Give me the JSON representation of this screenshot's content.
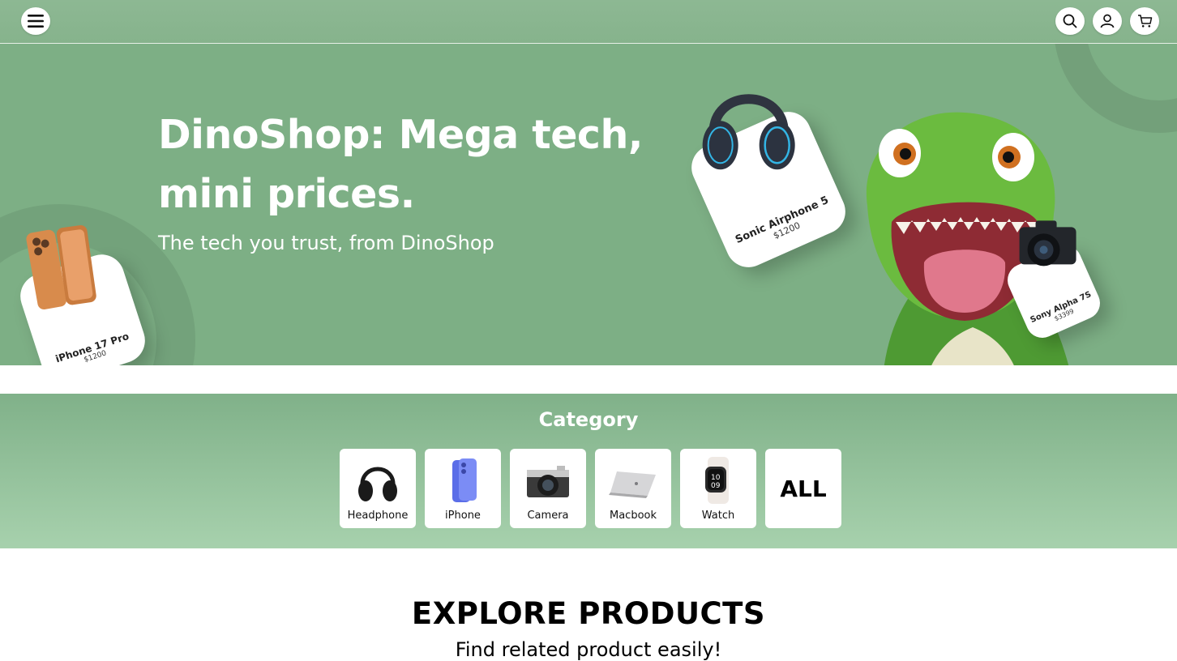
{
  "header": {
    "menu_icon": "hamburger-menu-icon",
    "actions": [
      {
        "name": "search",
        "icon": "search-icon"
      },
      {
        "name": "account",
        "icon": "user-icon"
      },
      {
        "name": "cart",
        "icon": "cart-icon"
      }
    ]
  },
  "hero": {
    "title_line1": "DinoShop: Mega tech,",
    "title_line2": "mini prices.",
    "subtitle": "The tech you trust, from DinoShop",
    "featured": [
      {
        "name": "iPhone 17 Pro",
        "price": "$1200"
      },
      {
        "name": "Sonic Airphone 5",
        "price": "$1200"
      },
      {
        "name": "Sony Alpha 7S",
        "price": "$3399"
      }
    ]
  },
  "category": {
    "title": "Category",
    "items": [
      {
        "label": "Headphone",
        "icon": "headphone-icon"
      },
      {
        "label": "iPhone",
        "icon": "iphone-icon"
      },
      {
        "label": "Camera",
        "icon": "camera-icon"
      },
      {
        "label": "Macbook",
        "icon": "macbook-icon"
      },
      {
        "label": "Watch",
        "icon": "watch-icon"
      },
      {
        "label": "ALL",
        "icon": ""
      }
    ]
  },
  "explore": {
    "title": "EXPLORE PRODUCTS",
    "subtitle": "Find related product easily!"
  },
  "colors": {
    "brand_green": "#7daf85",
    "header_green": "#8db893",
    "dino_green": "#5fae3c"
  }
}
